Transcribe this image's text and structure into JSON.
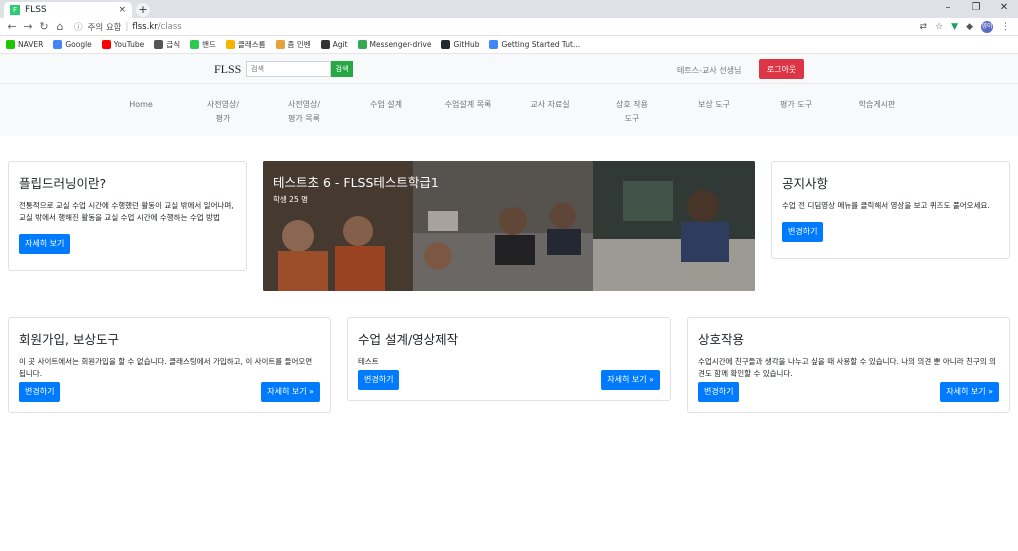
{
  "browser": {
    "tab_title": "FLSS",
    "tab_favicon": "F",
    "address_warning": "주의 요함",
    "url_host": "flss.kr",
    "url_path": "/class",
    "avatar_initials": "영미",
    "bookmarks": [
      {
        "label": "NAVER",
        "icon": "naver-icon",
        "color": "#1ec800"
      },
      {
        "label": "Google",
        "icon": "google-icon",
        "color": "#4285f4"
      },
      {
        "label": "YouTube",
        "icon": "youtube-icon",
        "color": "#ff0000"
      },
      {
        "label": "급식",
        "icon": "globe-icon",
        "color": "#555555"
      },
      {
        "label": "밴드",
        "icon": "band-icon",
        "color": "#2dc84d"
      },
      {
        "label": "클래스룸",
        "icon": "classroom-icon",
        "color": "#f4b400"
      },
      {
        "label": "좀 인벤",
        "icon": "inven-icon",
        "color": "#e6a23c"
      },
      {
        "label": "Agit",
        "icon": "agit-icon",
        "color": "#333333"
      },
      {
        "label": "Messenger-drive",
        "icon": "drive-icon",
        "color": "#34a853"
      },
      {
        "label": "GitHub",
        "icon": "github-icon",
        "color": "#24292e"
      },
      {
        "label": "Getting Started Tut...",
        "icon": "chrome-icon",
        "color": "#4285f4"
      }
    ]
  },
  "header": {
    "brand": "FLSS",
    "search_placeholder": "검색",
    "search_button": "검색",
    "user": "테트스-교사 선생님",
    "logout": "로그아웃"
  },
  "menu": [
    "Home",
    "사전영상/\n평가",
    "사전영상/\n평가 목록",
    "수업 설계",
    "수업설계 목록",
    "교사 자료실",
    "상호 작용\n도구",
    "보상 도구",
    "평가 도구",
    "학습게시판"
  ],
  "flipped": {
    "title": "플립드러닝이란?",
    "text": "전통적으로 교실 수업 시간에 수행했던 활동이 교실 밖에서 일어나며, 교실 밖에서 행해진 활동을 교실 수업 시간에 수행하는 수업 방법",
    "button": "자세히 보기"
  },
  "hero": {
    "title": "테스트초 6 - FLSS테스트학급1",
    "subtitle": "학생 25 명"
  },
  "notice": {
    "title": "공지사항",
    "text": "수업 전 디딤영상 메뉴를 클릭해서 영상을 보고 퀴즈도 풀어오세요.",
    "button": "변경하기"
  },
  "cards": [
    {
      "title": "회원가입, 보상도구",
      "text": "이 곳 사이트에서는 회원가입을 할 수 없습니다. 클래스팅에서 가입하고, 이 사이트를 들어오면 됩니다.",
      "edit": "변경하기",
      "more": "자세히 보기 »"
    },
    {
      "title": "수업 설계/영상제작",
      "text": "테스트",
      "edit": "변경하기",
      "more": "자세히 보기 »"
    },
    {
      "title": "상호작용",
      "text": "수업시간에 친구들과 생각을 나누고 싶을 때 사용할 수 있습니다. 나의 의견 뿐 아니라 친구의 의견도 함께 확인할 수 있습니다.",
      "edit": "변경하기",
      "more": "자세히 보기 »"
    }
  ]
}
